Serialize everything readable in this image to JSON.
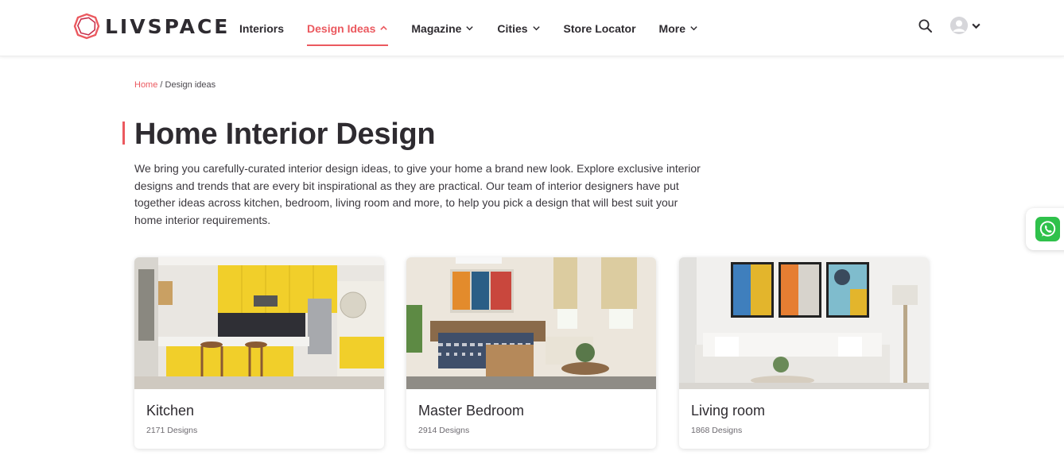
{
  "brand": {
    "name": "LIVSPACE",
    "accent": "#eb595f",
    "text_color": "#2e2b30"
  },
  "nav": {
    "items": [
      {
        "label": "Interiors",
        "has_dropdown": false,
        "active": false
      },
      {
        "label": "Design Ideas",
        "has_dropdown": true,
        "active": true
      },
      {
        "label": "Magazine",
        "has_dropdown": true,
        "active": false
      },
      {
        "label": "Cities",
        "has_dropdown": true,
        "active": false
      },
      {
        "label": "Store Locator",
        "has_dropdown": false,
        "active": false
      },
      {
        "label": "More",
        "has_dropdown": true,
        "active": false
      }
    ],
    "icons": {
      "search": "search-icon",
      "avatar": "user-avatar-icon",
      "whatsapp": "whatsapp-icon"
    }
  },
  "breadcrumb": {
    "home": "Home",
    "separator": " / ",
    "current": "Design ideas"
  },
  "page": {
    "title": "Home Interior Design",
    "intro": "We bring you carefully-curated interior design ideas, to give your home a brand new look. Explore exclusive interior designs and trends that are every bit inspirational as they are practical. Our team of interior designers have put together ideas across kitchen, bedroom, living room and more, to help you pick a design that will best suit your home interior requirements."
  },
  "cards": [
    {
      "title": "Kitchen",
      "count": "2171 Designs"
    },
    {
      "title": "Master Bedroom",
      "count": "2914 Designs"
    },
    {
      "title": "Living room",
      "count": "1868 Designs"
    }
  ]
}
